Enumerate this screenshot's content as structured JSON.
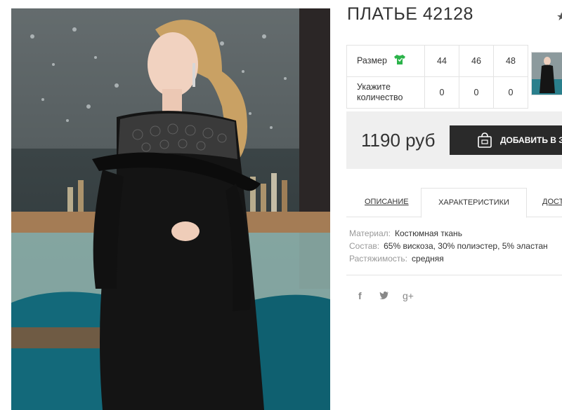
{
  "product": {
    "title": "ПЛАТЬЕ 42128",
    "favorite_icon": "star-icon"
  },
  "sizes_table": {
    "size_label": "Размер",
    "size_icon": "tshirt-icon",
    "size_icon_color": "#2bb34a",
    "sizes": [
      "44",
      "46",
      "48"
    ],
    "quantity_label": "Укажите количество",
    "quantities": [
      "0",
      "0",
      "0"
    ]
  },
  "purchase": {
    "price": "1190 руб",
    "add_to_cart_label": "ДОБАВИТЬ В ЗАКАЗ",
    "add_to_cart_icon": "shopping-bag-icon"
  },
  "tabs": [
    {
      "label": "ОПИСАНИЕ",
      "active": false
    },
    {
      "label": "ХАРАКТЕРИСТИКИ",
      "active": true
    },
    {
      "label": "ДОСТАВКА",
      "active": false
    }
  ],
  "specs": [
    {
      "key": "Материал:",
      "value": "Костюмная ткань"
    },
    {
      "key": "Состав:",
      "value": "65% вискоза, 30% полиэстер, 5% эластан"
    },
    {
      "key": "Растяжимость:",
      "value": "средняя"
    }
  ],
  "social": {
    "facebook": "f",
    "twitter_icon": "twitter-icon",
    "googleplus": "g+"
  },
  "colors": {
    "button_bg": "#2a2a2a",
    "price_box_bg": "#efefef",
    "accent_green": "#2bb34a"
  }
}
